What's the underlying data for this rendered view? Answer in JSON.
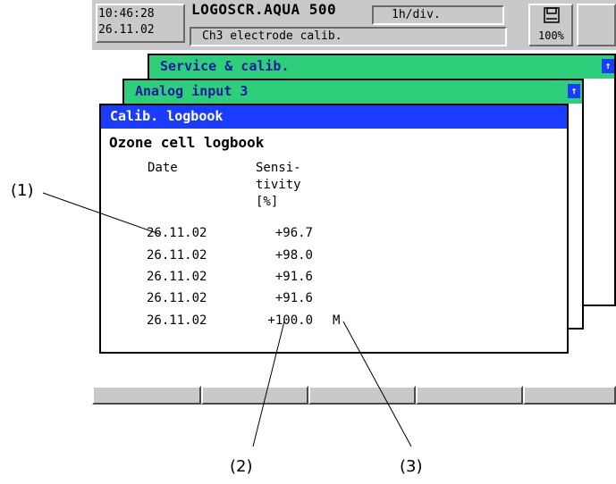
{
  "header": {
    "time": "10:46:28",
    "date": "26.11.02",
    "instrument": "LOGOSCR.AQUA 500",
    "timebase": "1h/div.",
    "channel_info": "Ch3 electrode calib.",
    "memory_percent": "100%",
    "memory_icon": "floppy-disk-icon"
  },
  "windows": {
    "back": {
      "title": "Service & calib."
    },
    "middle": {
      "title": "Analog input 3"
    },
    "front": {
      "title": "Calib. logbook"
    }
  },
  "logbook": {
    "heading": "Ozone cell logbook",
    "col_date": "Date",
    "col_sens_1": "Sensi-",
    "col_sens_2": "tivity",
    "col_sens_3": "[%]",
    "rows": [
      {
        "date": "26.11.02",
        "value": "+96.7",
        "flag": ""
      },
      {
        "date": "26.11.02",
        "value": "+98.0",
        "flag": ""
      },
      {
        "date": "26.11.02",
        "value": "+91.6",
        "flag": ""
      },
      {
        "date": "26.11.02",
        "value": "+91.6",
        "flag": ""
      },
      {
        "date": "26.11.02",
        "value": "+100.0",
        "flag": "M"
      }
    ]
  },
  "softkeys": [
    "",
    "",
    "",
    "",
    ""
  ],
  "callouts": {
    "c1": "(1)",
    "c2": "(2)",
    "c3": "(3)"
  },
  "colors": {
    "title_green": "#2ecf7a",
    "title_blue": "#1a3cff",
    "panel_gray": "#c9c9c9"
  }
}
